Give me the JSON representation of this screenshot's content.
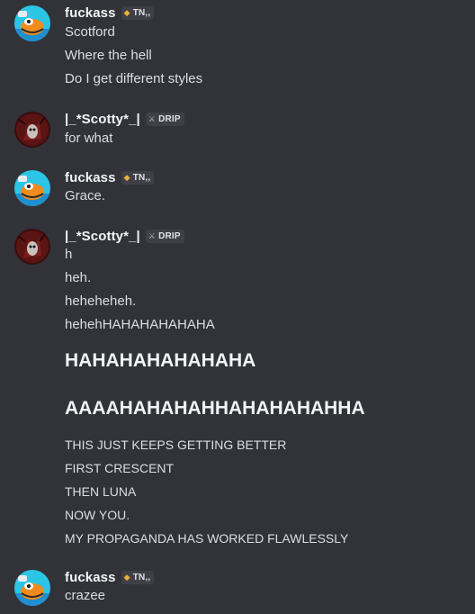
{
  "colors": {
    "background": "#323339",
    "text": "#dbdee1",
    "username": "#f2f3f5",
    "tag_bg": "#3f4047",
    "tag_icon_tn": "#f0b232",
    "tag_icon_drip": "#b5bac1"
  },
  "groups": [
    {
      "user": "fuckass",
      "tag": {
        "icon": "leaf-icon",
        "label": "TN,,"
      },
      "lines": [
        "Scotford",
        "Where the hell",
        "Do I get different styles"
      ]
    },
    {
      "user": "|_*Scotty*_|",
      "tag": {
        "icon": "sword-icon",
        "label": "DRIP"
      },
      "lines": [
        "for what"
      ]
    },
    {
      "user": "fuckass",
      "tag": {
        "icon": "leaf-icon",
        "label": "TN,,"
      },
      "lines": [
        "Grace."
      ]
    },
    {
      "user": "|_*Scotty*_|",
      "tag": {
        "icon": "sword-icon",
        "label": "DRIP"
      },
      "lines": [
        "h",
        "heh.",
        "heheheheh.",
        "hehehHAHAHAHAHAHA",
        "HAHAHAHAHAHAHA",
        "AAAAHAHAHAHHAHAHAHAHHA",
        "THIS JUST KEEPS GETTING BETTER",
        "FIRST CRESCENT",
        "THEN LUNA",
        "NOW YOU.",
        "MY PROPAGANDA HAS WORKED FLAWLESSLY"
      ]
    },
    {
      "user": "fuckass",
      "tag": {
        "icon": "leaf-icon",
        "label": "TN,,"
      },
      "lines": [
        "crazee"
      ]
    }
  ]
}
